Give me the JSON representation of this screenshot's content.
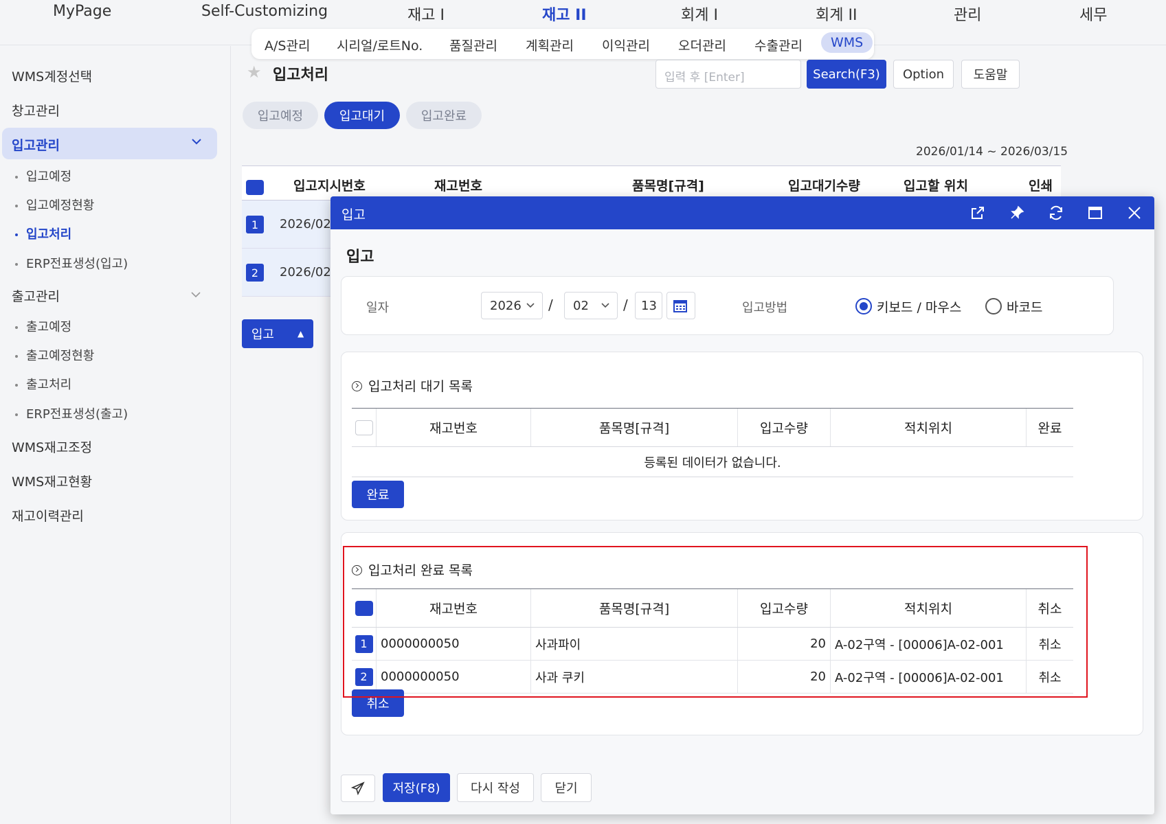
{
  "topnav": {
    "items": [
      "MyPage",
      "Self-Customizing",
      "재고 I",
      "재고 II",
      "회계 I",
      "회계 II",
      "관리",
      "세무"
    ],
    "active_index": 3
  },
  "subnav": {
    "items": [
      "A/S관리",
      "시리얼/로트No.",
      "품질관리",
      "계획관리",
      "이익관리",
      "오더관리",
      "수출관리",
      "WMS"
    ],
    "active_index": 7
  },
  "sidebar": {
    "item_wms_account": "WMS계정선택",
    "item_warehouse": "창고관리",
    "group_inbound": "입고관리",
    "inbound_subs": [
      "입고예정",
      "입고예정현황",
      "입고처리",
      "ERP전표생성(입고)"
    ],
    "group_outbound": "출고관리",
    "outbound_subs": [
      "출고예정",
      "출고예정현황",
      "출고처리",
      "ERP전표생성(출고)"
    ],
    "item_adjust": "WMS재고조정",
    "item_status": "WMS재고현황",
    "item_history": "재고이력관리"
  },
  "main": {
    "title": "입고처리",
    "search_placeholder": "입력 후 [Enter]",
    "search_button": "Search(F3)",
    "option_button": "Option",
    "help_button": "도움말",
    "tabs": [
      "입고예정",
      "입고대기",
      "입고완료"
    ],
    "active_tab": 1,
    "date_range": "2026/01/14 ~ 2026/03/15",
    "table_headers": [
      "입고지시번호",
      "재고번호",
      "품목명[규격]",
      "입고대기수량",
      "입고할 위치",
      "인쇄"
    ],
    "rows": [
      {
        "num": "1",
        "date": "2026/02/"
      },
      {
        "num": "2",
        "date": "2026/02/"
      }
    ],
    "inbound_button": "입고"
  },
  "modal": {
    "header": "입고",
    "title": "입고",
    "date_label": "일자",
    "year": "2026",
    "month": "02",
    "day": "13",
    "method_label": "입고방법",
    "radio_keyboard": "키보드 / 마우스",
    "radio_barcode": "바코드",
    "pending": {
      "title": "입고처리 대기 목록",
      "headers": [
        "재고번호",
        "품목명[규격]",
        "입고수량",
        "적치위치",
        "완료"
      ],
      "empty_text": "등록된 데이터가 없습니다.",
      "button": "완료"
    },
    "done": {
      "title": "입고처리 완료 목록",
      "headers": [
        "재고번호",
        "품목명[규격]",
        "입고수량",
        "적치위치",
        "취소"
      ],
      "rows": [
        {
          "num": "1",
          "stock_no": "0000000050",
          "item": "사과파이",
          "qty": "20",
          "location": "A-02구역 - [00006]A-02-001",
          "action": "취소"
        },
        {
          "num": "2",
          "stock_no": "0000000050",
          "item": "사과 쿠키",
          "qty": "20",
          "location": "A-02구역 - [00006]A-02-001",
          "action": "취소"
        }
      ],
      "button": "취소"
    },
    "footer": {
      "save": "저장(F8)",
      "rewrite": "다시 작성",
      "close": "닫기"
    }
  },
  "colors": {
    "accent": "#2446c9",
    "highlight": "#e0131e"
  }
}
